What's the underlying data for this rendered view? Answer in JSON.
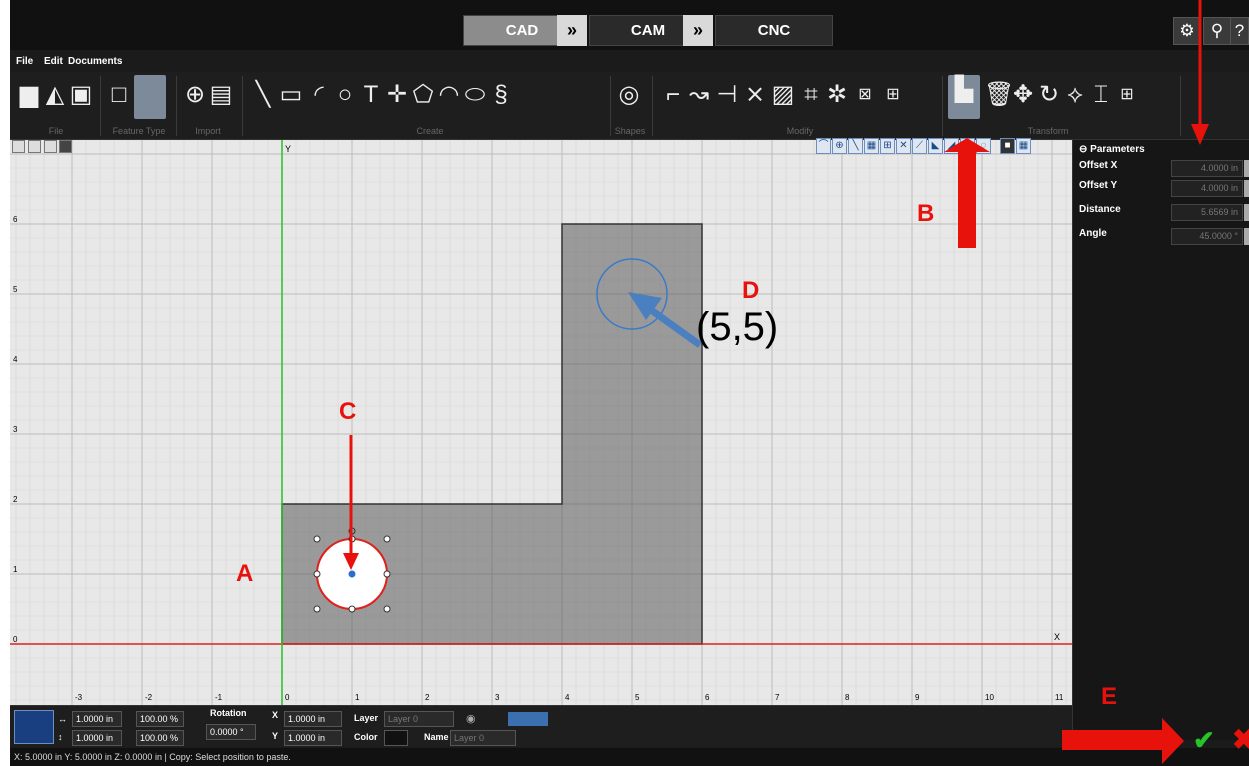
{
  "modes": {
    "cad": "CAD",
    "arrow1": "»",
    "cam": "CAM",
    "arrow2": "»",
    "cnc": "CNC"
  },
  "system_buttons": {
    "settings_icon": "gear-icon",
    "search_icon": "search-icon",
    "help": "?"
  },
  "menu": {
    "file": "File",
    "edit": "Edit",
    "documents": "Documents"
  },
  "ribbon_groups": {
    "file": "File",
    "feature_type": "Feature Type",
    "import": "Import",
    "create": "Create",
    "shapes": "Shapes",
    "modify": "Modify",
    "transform": "Transform"
  },
  "canvas": {
    "y_axis_label": "Y",
    "x_axis_label": "X",
    "x_ticks": [
      "-3",
      "-2",
      "-1",
      "0",
      "1",
      "2",
      "3",
      "4",
      "5",
      "6",
      "7",
      "8",
      "9",
      "10",
      "11"
    ],
    "y_ticks": [
      "0",
      "1",
      "2",
      "3",
      "4",
      "5",
      "6"
    ],
    "axis_color": "#e0201a",
    "y_axis_color": "#26c026"
  },
  "parameters": {
    "title": "Parameters",
    "rows": [
      {
        "label": "Offset X",
        "value": "4.0000 in"
      },
      {
        "label": "Offset Y",
        "value": "4.0000 in"
      },
      {
        "label": "Distance",
        "value": "5.6569 in"
      },
      {
        "label": "Angle",
        "value": "45.0000 °"
      }
    ]
  },
  "propbar": {
    "width": "1.0000 in",
    "width_pct": "100.00 %",
    "height": "1.0000 in",
    "height_pct": "100.00 %",
    "rotation_label": "Rotation",
    "rotation_value": "0.0000 °",
    "x_label": "X",
    "x_value": "1.0000 in",
    "y_label": "Y",
    "y_value": "1.0000 in",
    "layer_label": "Layer",
    "layer_value": "Layer 0",
    "color_label": "Color",
    "name_label": "Name",
    "name_placeholder": "Layer 0"
  },
  "status": "X: 5.0000 in   Y: 5.0000 in   Z: 0.0000 in   |   Copy: Select position to paste.",
  "annotations": {
    "a": "A",
    "b": "B",
    "c": "C",
    "d": "D",
    "e": "E",
    "coord": "(5,5)",
    "color": "#e8120c"
  },
  "actions": {
    "ok": "✔",
    "cancel": "✖"
  }
}
